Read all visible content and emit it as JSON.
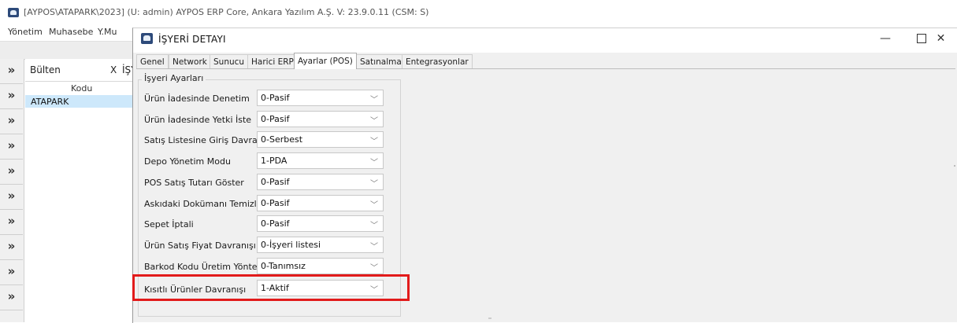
{
  "main_window": {
    "title": "[AYPOS\\ATAPARK\\2023] (U: admin) AYPOS ERP Core, Ankara Yazılım A.Ş. V: 23.9.0.11 (CSM: S)",
    "menu": [
      "Yönetim",
      "Muhasebe",
      "Y.Mu"
    ]
  },
  "background_tabs": {
    "bulten_label": "Bülten",
    "bulten_close": "X",
    "isyeri_label": "İŞY"
  },
  "left_nav": {
    "chevron": "»"
  },
  "grid": {
    "column_header": "Kodu",
    "rows": [
      "ATAPARK"
    ]
  },
  "dialog": {
    "title": "İŞYERİ DETAYI",
    "buttons": {
      "minimize": "—",
      "close": "✕"
    },
    "tabs": [
      {
        "label": "Genel",
        "active": false
      },
      {
        "label": "Network",
        "active": false
      },
      {
        "label": "Sunucu",
        "active": false
      },
      {
        "label": "Harici ERP",
        "active": false
      },
      {
        "label": "Ayarlar (POS)",
        "active": true
      },
      {
        "label": "Satınalma",
        "active": false
      },
      {
        "label": "Entegrasyonlar",
        "active": false
      }
    ],
    "group_title": "İşyeri Ayarları",
    "settings": [
      {
        "label": "Ürün İadesinde Denetim",
        "value": "0-Pasif"
      },
      {
        "label": "Ürün İadesinde Yetki İste",
        "value": "0-Pasif"
      },
      {
        "label": "Satış Listesine Giriş Davranışı",
        "value": "0-Serbest"
      },
      {
        "label": "Depo Yönetim Modu",
        "value": "1-PDA"
      },
      {
        "label": "POS Satış Tutarı Göster",
        "value": "0-Pasif"
      },
      {
        "label": "Askıdaki Dokümanı Temizle",
        "value": "0-Pasif"
      },
      {
        "label": "Sepet İptali",
        "value": "0-Pasif"
      },
      {
        "label": "Ürün Satış Fiyat Davranışı",
        "value": "0-İşyeri listesi"
      },
      {
        "label": "Barkod Kodu Üretim Yöntemi",
        "value": "0-Tanımsız"
      },
      {
        "label": "Kısıtlı Ürünler Davranışı",
        "value": "1-Aktif"
      }
    ],
    "dropdown_arrow": "﹀"
  },
  "colors": {
    "highlight": "#e21b1b",
    "selected_row": "#cde8fb",
    "dialog_bg": "#f0f0f0"
  }
}
